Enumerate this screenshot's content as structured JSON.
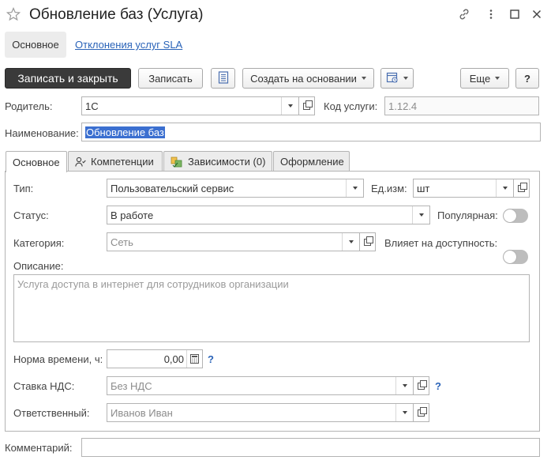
{
  "window": {
    "title": "Обновление баз (Услуга)",
    "icons": [
      "star-icon",
      "link-icon",
      "more-vertical-icon",
      "maximize-icon",
      "close-icon"
    ]
  },
  "nav": {
    "tab_main": "Основное",
    "tab_sla": "Отклонения услуг SLA"
  },
  "toolbar": {
    "save_close": "Записать и закрыть",
    "save": "Записать",
    "create_based": "Создать на основании",
    "more": "Еще",
    "help": "?"
  },
  "header": {
    "parent_label": "Родитель:",
    "parent_value": "1С",
    "code_label": "Код услуги:",
    "code_value": "1.12.4",
    "name_label": "Наименование:",
    "name_value": "Обновление баз"
  },
  "tabs": [
    {
      "label": "Основное"
    },
    {
      "label": "Компетенции"
    },
    {
      "label": "Зависимости (0)"
    },
    {
      "label": "Оформление"
    }
  ],
  "form": {
    "type_label": "Тип:",
    "type_value": "Пользовательский сервис",
    "unit_label": "Ед.изм:",
    "unit_value": "шт",
    "status_label": "Статус:",
    "status_value": "В работе",
    "popular_label": "Популярная:",
    "popular_on": false,
    "category_label": "Категория:",
    "category_placeholder": "Сеть",
    "affects_label": "Влияет на доступность:",
    "affects_on": false,
    "description_label": "Описание:",
    "description_placeholder": "Услуга доступа в интернет для сотрудников организации",
    "time_norm_label": "Норма времени, ч:",
    "time_norm_value": "0,00",
    "vat_label": "Ставка НДС:",
    "vat_placeholder": "Без НДС",
    "responsible_label": "Ответственный:",
    "responsible_placeholder": "Иванов Иван",
    "help_mark": "?"
  },
  "footer": {
    "comment_label": "Комментарий:",
    "comment_value": ""
  },
  "colors": {
    "link": "#2a63b8",
    "primary_button": "#3a3a3a",
    "selection": "#3b6fd0"
  }
}
